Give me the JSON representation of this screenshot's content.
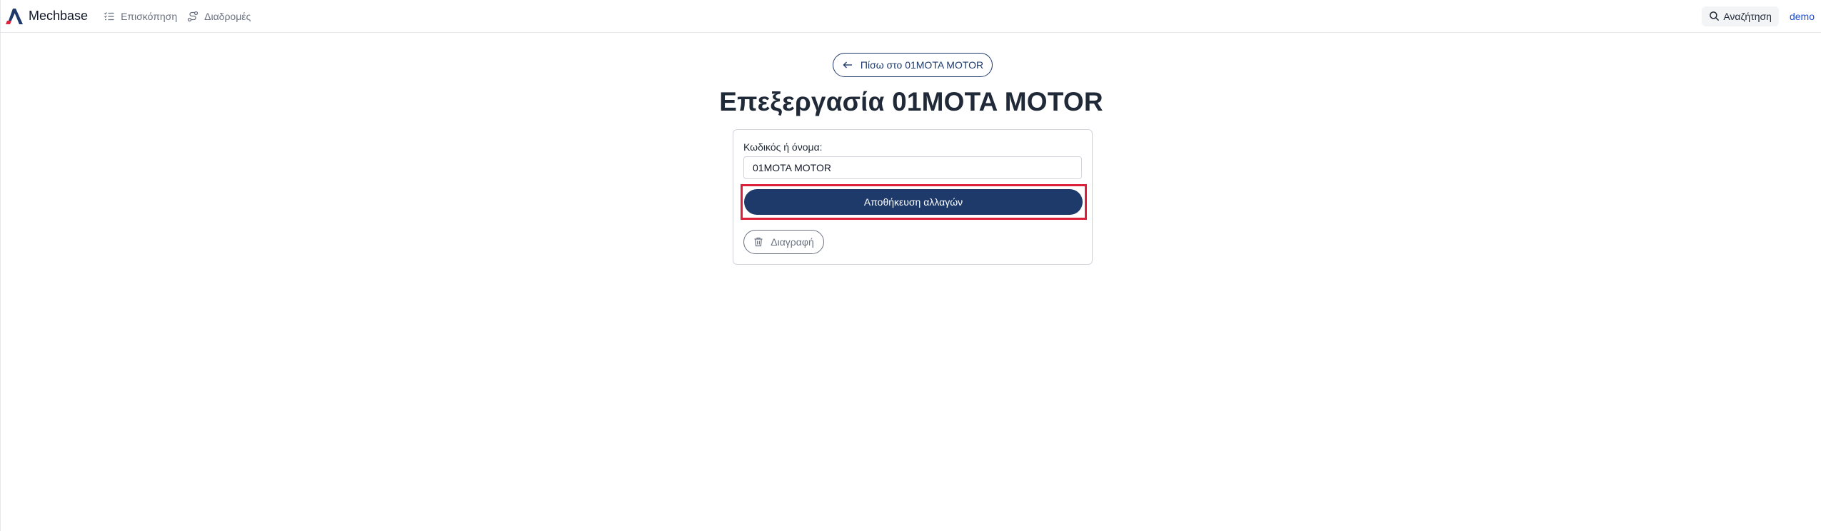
{
  "nav": {
    "brand": "Mechbase",
    "links": [
      {
        "label": "Επισκόπηση",
        "icon": "list-check-icon"
      },
      {
        "label": "Διαδρομές",
        "icon": "route-icon"
      }
    ],
    "search_label": "Αναζήτηση",
    "user": "demo"
  },
  "main": {
    "back_label": "Πίσω στο 01MOTA MOTOR",
    "title": "Επεξεργασία 01MOTA MOTOR",
    "form": {
      "field_label": "Κωδικός ή όνομα:",
      "field_value": "01MOTA MOTOR",
      "save_label": "Αποθήκευση αλλαγών",
      "delete_label": "Διαγραφή"
    }
  },
  "colors": {
    "primary": "#1e3a6b",
    "highlight": "#dc1f3b",
    "brand_dark": "#1e3a6b",
    "brand_red": "#e0263f"
  }
}
